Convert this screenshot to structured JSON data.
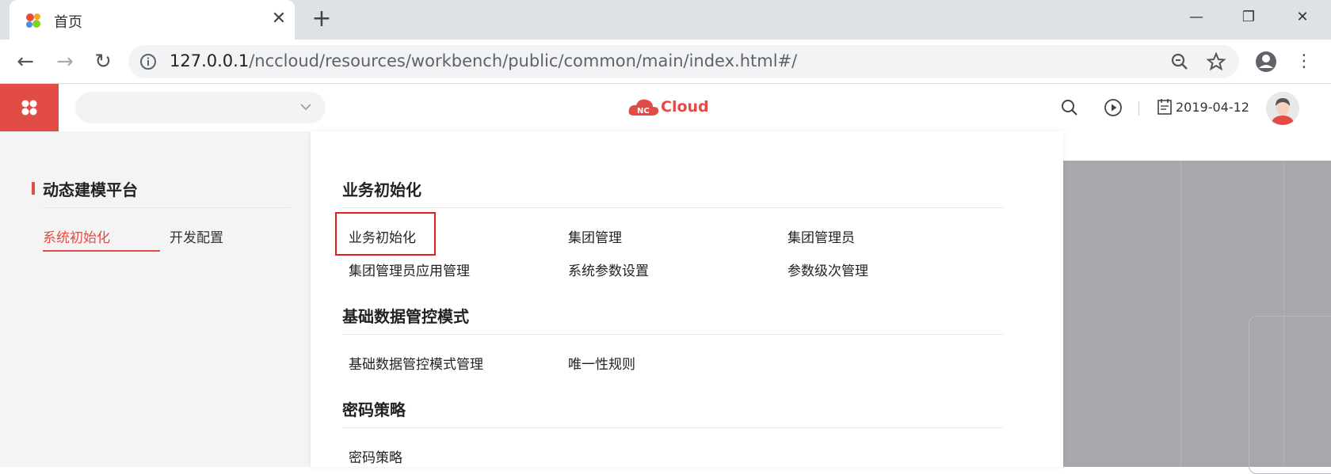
{
  "browser": {
    "tab_title": "首页",
    "url_host": "127.0.0.1",
    "url_path": "/nccloud/resources/workbench/public/common/main/index.html#/"
  },
  "header": {
    "logo_badge": "NC",
    "logo_text": "Cloud",
    "date": "2019-04-12",
    "brand_color": "#e14c46"
  },
  "leftnav": {
    "title": "动态建模平台",
    "tabs": [
      {
        "label": "系统初始化",
        "active": true
      },
      {
        "label": "开发配置",
        "active": false
      }
    ]
  },
  "sections": [
    {
      "title": "业务初始化",
      "items": [
        "业务初始化",
        "集团管理",
        "集团管理员",
        "集团管理员应用管理",
        "系统参数设置",
        "参数级次管理"
      ]
    },
    {
      "title": "基础数据管控模式",
      "items": [
        "基础数据管控模式管理",
        "唯一性规则"
      ]
    },
    {
      "title": "密码策略",
      "items": [
        "密码策略"
      ]
    }
  ]
}
